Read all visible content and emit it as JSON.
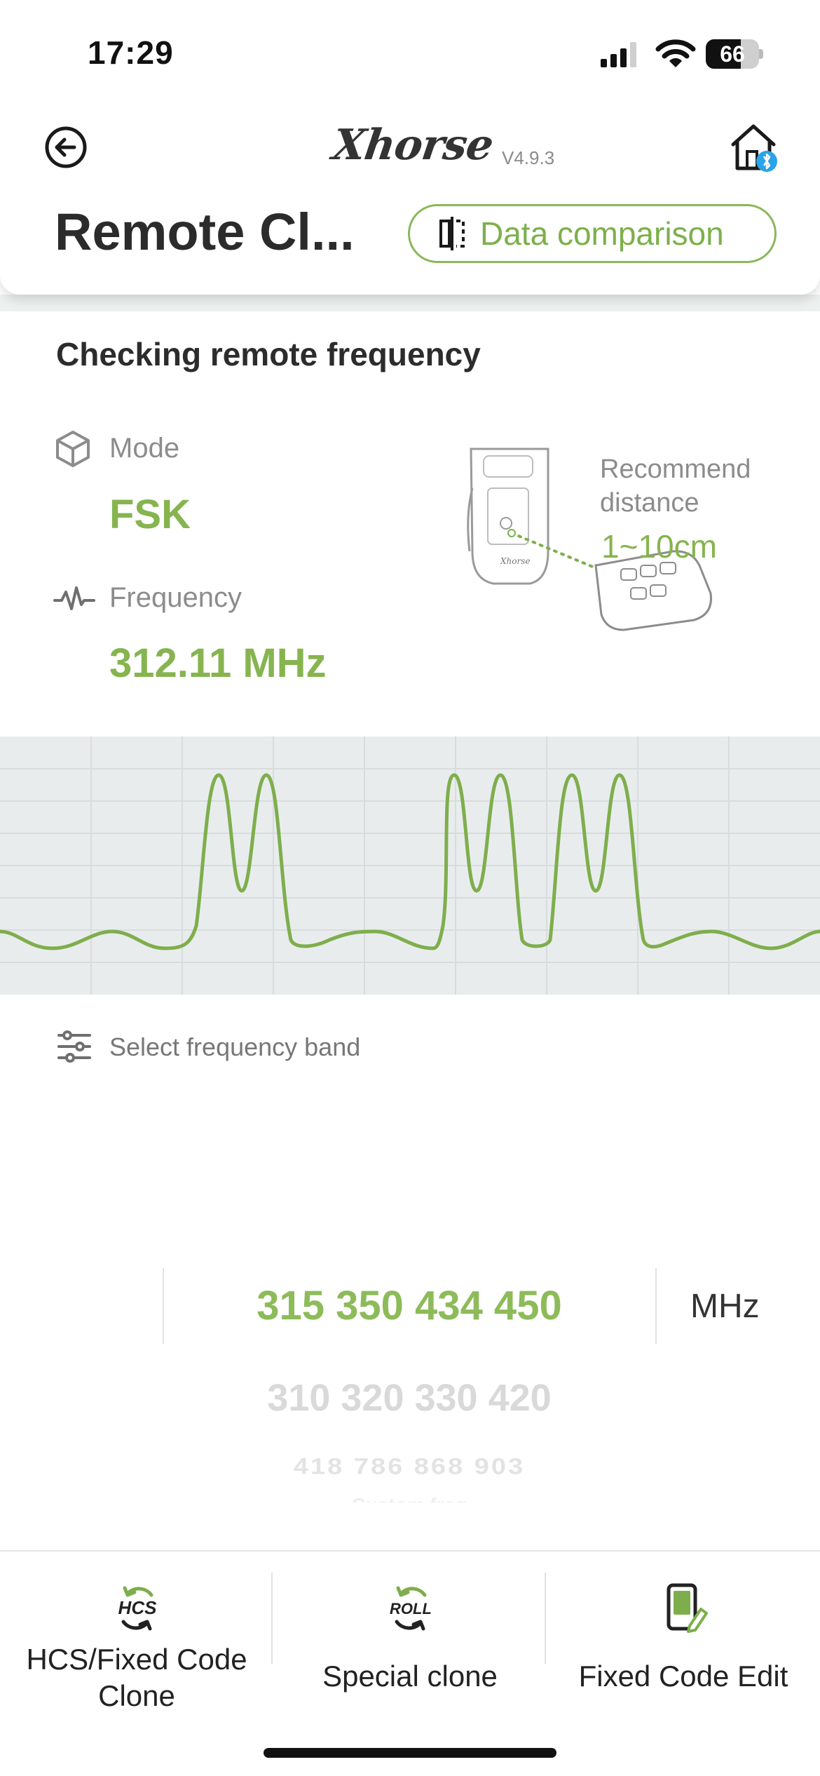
{
  "status_bar": {
    "time": "17:29",
    "battery_level": "66",
    "battery_fraction": 0.66,
    "icons": [
      "cellular-signal-icon",
      "wifi-icon",
      "battery-icon"
    ]
  },
  "header": {
    "brand": "Xhorse",
    "version": "V4.9.3",
    "title": "Remote Cl...",
    "compare_button": "Data comparison",
    "icons": [
      "back-arrow-icon",
      "home-bluetooth-icon",
      "data-compare-icon"
    ]
  },
  "status": {
    "heading": "Checking remote frequency",
    "mode_label": "Mode",
    "mode_value": "FSK",
    "frequency_label": "Frequency",
    "frequency_value": "312.11 MHz",
    "recommend_label": "Recommend distance",
    "recommend_value": "1~10cm",
    "icons": [
      "cube-icon",
      "pulse-icon"
    ]
  },
  "frequency_band": {
    "label": "Select frequency band",
    "selected": "315 350 434 450",
    "options_next": "310 320 330 420",
    "options_next2": "418 786 868 903",
    "options_next3": "Custom freq",
    "unit": "MHz",
    "icon": "sliders-icon"
  },
  "toolbar": {
    "items": [
      {
        "label": "HCS/Fixed Code Clone",
        "icon": "hcs-icon",
        "icon_text": "HCS"
      },
      {
        "label": "Special clone",
        "icon": "roll-icon",
        "icon_text": "ROLL"
      },
      {
        "label": "Fixed Code Edit",
        "icon": "edit-device-icon"
      }
    ]
  },
  "colors": {
    "accent_green": "#86b44f",
    "waveform_bg": "#e9eced",
    "text_dark": "#2b2b2b",
    "text_gray": "#8c8c8c"
  }
}
